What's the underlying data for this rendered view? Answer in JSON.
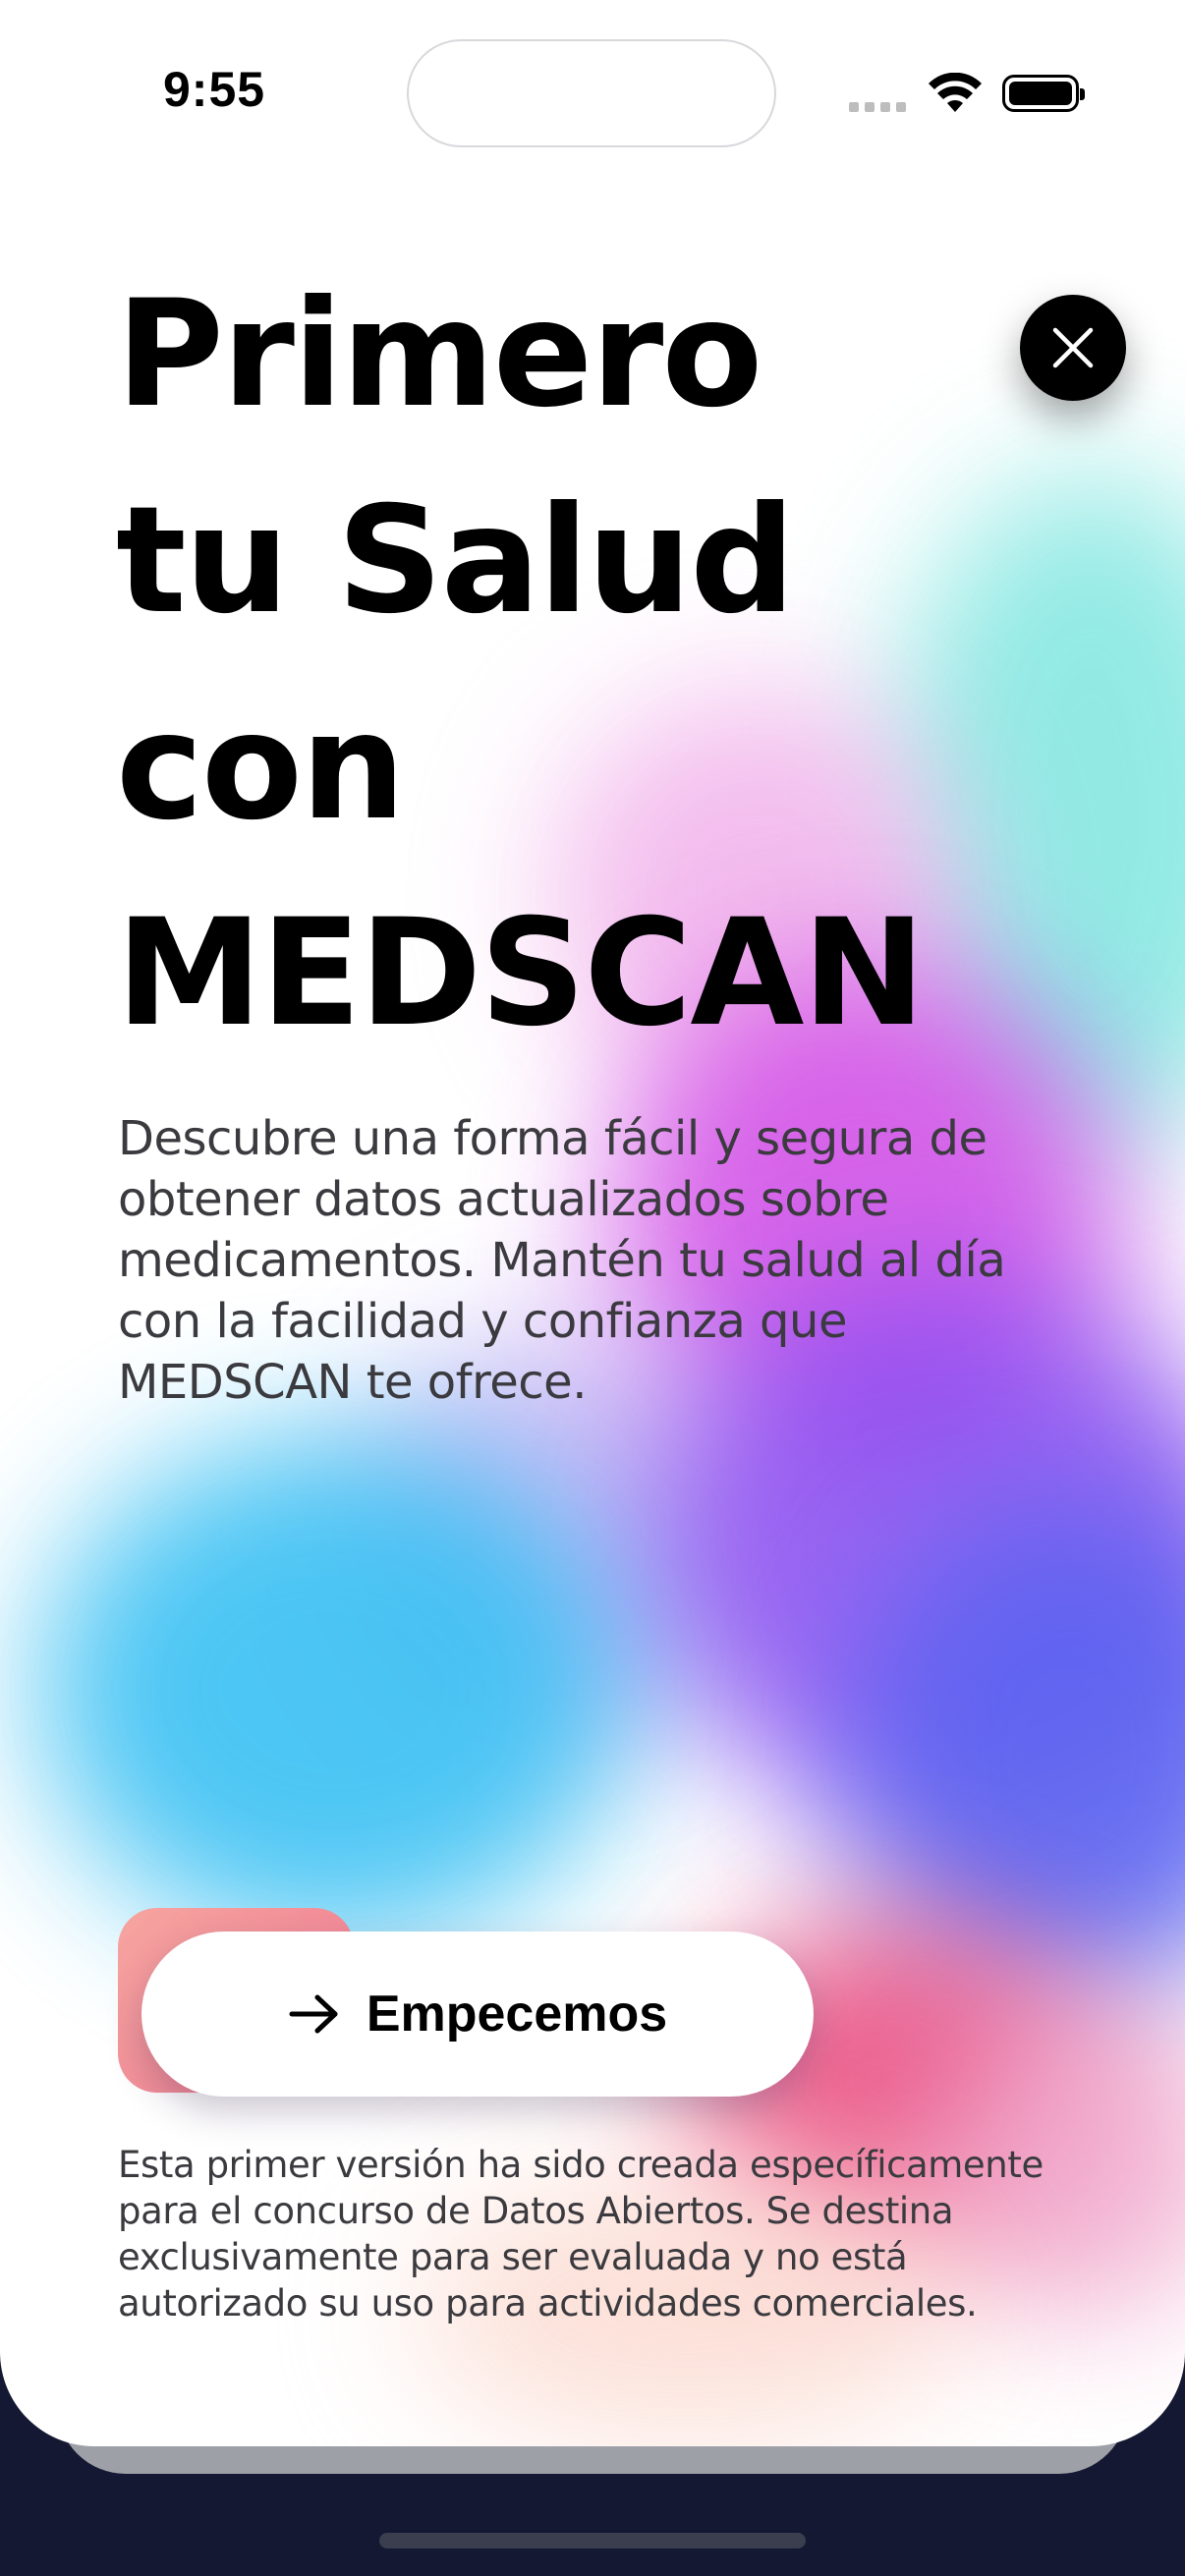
{
  "status_bar": {
    "time": "9:55",
    "icons": [
      "signal-icon",
      "wifi-icon",
      "battery-icon"
    ]
  },
  "close_button": {
    "icon": "close-icon"
  },
  "headline": {
    "line1": "Primero",
    "line2": "tu Salud",
    "line3": "con",
    "line4": "MEDSCAN"
  },
  "description": "Descubre una forma fácil y segura de obtener datos actualizados sobre medicamentos. Mantén tu salud al día con la facilidad y confianza que MEDSCAN te ofrece.",
  "cta": {
    "icon": "arrow-right-icon",
    "label": "Empecemos"
  },
  "disclaimer": "Esta primer versión ha sido creada específicamente para el concurso de Datos Abiertos. Se destina exclusivamente para ser evaluada y no está autorizado su uso para actividades comerciales.",
  "colors": {
    "text": "#000000",
    "body_text": "#3a3a3f",
    "cyan": "#39c0f3",
    "purple": "#8a4df0",
    "magenta": "#d04ae6",
    "indigo": "#5b64f0",
    "pink": "#e8457a",
    "teal": "#7fe6e0",
    "cta_accent": "#f07a92"
  }
}
